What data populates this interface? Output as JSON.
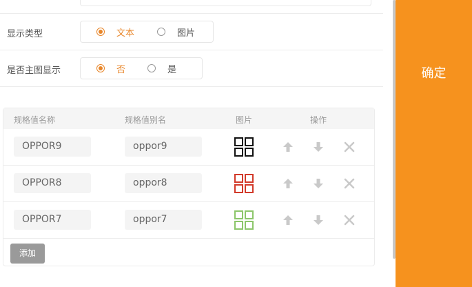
{
  "form": {
    "display_type": {
      "label": "显示类型",
      "options": [
        {
          "label": "文本",
          "checked": true
        },
        {
          "label": "图片",
          "checked": false
        }
      ]
    },
    "main_image": {
      "label": "是否主图显示",
      "options": [
        {
          "label": "否",
          "checked": true
        },
        {
          "label": "是",
          "checked": false
        }
      ]
    }
  },
  "table": {
    "headers": [
      "规格值名称",
      "规格值别名",
      "图片",
      "操作"
    ],
    "rows": [
      {
        "name": "OPPOR9",
        "alias": "oppor9",
        "icon_color": "#111111"
      },
      {
        "name": "OPPOR8",
        "alias": "oppor8",
        "icon_color": "#d23a2a"
      },
      {
        "name": "OPPOR7",
        "alias": "oppor7",
        "icon_color": "#8cc66a"
      }
    ],
    "add_label": "添加"
  },
  "actions": {
    "confirm_label": "确定"
  },
  "colors": {
    "accent": "#e8862a",
    "confirm_bg": "#f6921e"
  }
}
